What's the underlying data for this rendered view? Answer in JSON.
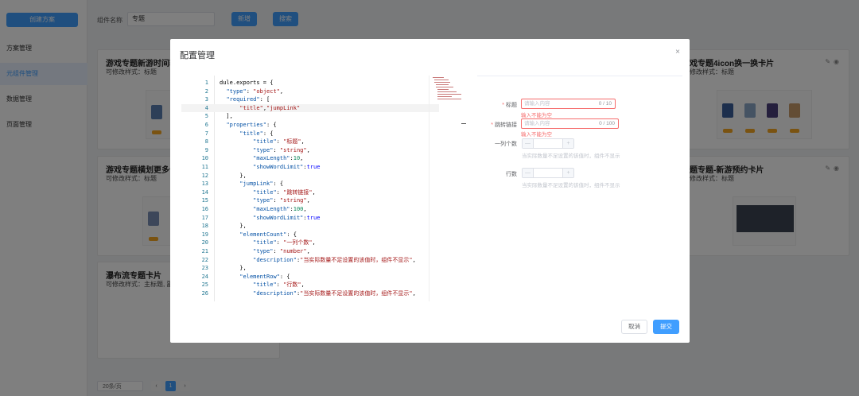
{
  "sidebar": {
    "create_button": "创建方案",
    "items": [
      {
        "label": "方案管理"
      },
      {
        "label": "元组件管理"
      },
      {
        "label": "数据管理"
      },
      {
        "label": "页面管理"
      }
    ]
  },
  "search": {
    "label": "组件名称",
    "value": "专题",
    "new_button": "新增",
    "search_button": "搜索"
  },
  "cards": [
    {
      "title": "游戏专题新游时间轴",
      "sub": "可修改样式：标题"
    },
    {
      "title": "游戏专题横划更多卡",
      "sub": "可修改样式：标题"
    },
    {
      "title": "瀑布流专题卡片",
      "sub": "可修改样式：主标题, 副"
    },
    {
      "title": "戏专题4icon换一换卡片",
      "sub": "修改样式：标题"
    },
    {
      "title": "题专题-新游预约卡片",
      "sub": "修改样式：标题"
    }
  ],
  "pagination": {
    "page_size": "20条/页",
    "prev": "‹",
    "current": "1",
    "next": "›"
  },
  "modal": {
    "title": "配置管理",
    "close": "×",
    "code_lines": [
      {
        "n": "1",
        "t": "dule.exports = {"
      },
      {
        "n": "2",
        "t": "  \"type\": \"object\","
      },
      {
        "n": "3",
        "t": "  \"required\": ["
      },
      {
        "n": "4",
        "t": "      \"title\",\"jumpLink\""
      },
      {
        "n": "5",
        "t": "  ],"
      },
      {
        "n": "6",
        "t": "  \"properties\": {"
      },
      {
        "n": "7",
        "t": "      \"title\": {"
      },
      {
        "n": "8",
        "t": "          \"title\": \"标题\","
      },
      {
        "n": "9",
        "t": "          \"type\": \"string\","
      },
      {
        "n": "10",
        "t": "          \"maxLength\":10,"
      },
      {
        "n": "11",
        "t": "          \"showWordLimit\":true"
      },
      {
        "n": "12",
        "t": "      },"
      },
      {
        "n": "13",
        "t": "      \"jumpLink\": {"
      },
      {
        "n": "14",
        "t": "          \"title\": \"跳转链接\","
      },
      {
        "n": "15",
        "t": "          \"type\": \"string\","
      },
      {
        "n": "16",
        "t": "          \"maxLength\":100,"
      },
      {
        "n": "17",
        "t": "          \"showWordLimit\":true"
      },
      {
        "n": "18",
        "t": "      },"
      },
      {
        "n": "19",
        "t": "      \"elementCount\": {"
      },
      {
        "n": "20",
        "t": "          \"title\": \"一列个数\","
      },
      {
        "n": "21",
        "t": "          \"type\": \"number\","
      },
      {
        "n": "22",
        "t": "          \"description\":\"当实际数量不足设置的该值时，组件不显示\","
      },
      {
        "n": "23",
        "t": "      },"
      },
      {
        "n": "24",
        "t": "      \"elementRow\": {"
      },
      {
        "n": "25",
        "t": "          \"title\": \"行数\","
      },
      {
        "n": "26",
        "t": "          \"description\":\"当实际数量不足设置的该值时，组件不显示\","
      }
    ],
    "form": {
      "title_field": {
        "label": "标题",
        "placeholder": "请输入内容",
        "count": "0 / 10",
        "error": "输入不能为空"
      },
      "link_field": {
        "label": "跳转链接",
        "placeholder": "请输入内容",
        "count": "0 / 100",
        "error": "输入不能为空"
      },
      "count_field": {
        "label": "一列个数",
        "minus": "—",
        "plus": "+",
        "description": "当实际数量不足设置的该值时，组件不显示"
      },
      "row_field": {
        "label": "行数",
        "minus": "—",
        "plus": "+",
        "description": "当实际数量不足设置的该值时，组件不显示"
      }
    },
    "cancel_button": "取消",
    "submit_button": "提交"
  },
  "colors": {
    "primary": "#409eff",
    "error": "#f56c6c",
    "overlay": "rgba(0,0,0,0.5)"
  }
}
